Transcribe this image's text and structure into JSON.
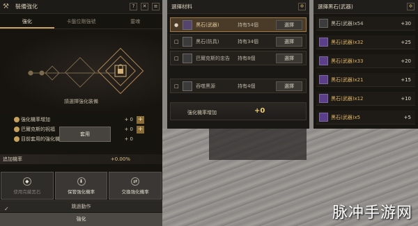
{
  "left": {
    "title": "裝備強化",
    "header_icons": [
      "?",
      "✕",
      "≡"
    ],
    "tabs": [
      {
        "label": "強化",
        "active": true
      },
      {
        "label": "卡盤位剛強號",
        "active": false
      },
      {
        "label": "靈魂",
        "active": false
      }
    ],
    "hint": "請選擇強化裝備",
    "stats": [
      {
        "label": "強化機率增加",
        "value": "+ 0"
      },
      {
        "label": "巴爾克斯的祝福",
        "value": "+ 0"
      },
      {
        "label": "目前套用的強化機率增加",
        "value": "+ 0"
      }
    ],
    "rate": {
      "label": "追加機率",
      "value": "+0.00%"
    },
    "buttons": [
      {
        "label": "使用完藏黑石"
      },
      {
        "label": "保管強化機率"
      },
      {
        "label": "交換強化機率"
      }
    ],
    "skip": {
      "check": "✓",
      "label": "跳過動作"
    },
    "enhance": "強化"
  },
  "middle": {
    "title": "選擇材料",
    "materials": [
      {
        "name": "黑石(武器)",
        "count": "持有54個",
        "action": "選擇",
        "selected": true,
        "marker": "●"
      },
      {
        "name": "黑石(防具)",
        "count": "持有34個",
        "action": "選擇",
        "selected": false,
        "marker": "□"
      },
      {
        "name": "巴爾克斯的忠告",
        "count": "持有8個",
        "action": "選擇",
        "selected": false,
        "marker": "□"
      }
    ],
    "extra": {
      "name": "吞噬黑源",
      "count": "持有4個",
      "action": "選擇",
      "marker": "□"
    },
    "rate": {
      "label": "強化機率增加",
      "value": "+0"
    },
    "apply": "套用"
  },
  "right": {
    "title": "選擇黑石(武器)",
    "stones": [
      {
        "name": "黑石(武器)x54",
        "value": "+30"
      },
      {
        "name": "黑石(武器)x32",
        "value": "+25"
      },
      {
        "name": "黑石(武器)x33",
        "value": "+20"
      },
      {
        "name": "黑石(武器)x21",
        "value": "+15"
      },
      {
        "name": "黑石(武器)x12",
        "value": "+10"
      },
      {
        "name": "黑石(武器)x5",
        "value": "+5"
      }
    ]
  },
  "watermark": "脉冲手游网"
}
